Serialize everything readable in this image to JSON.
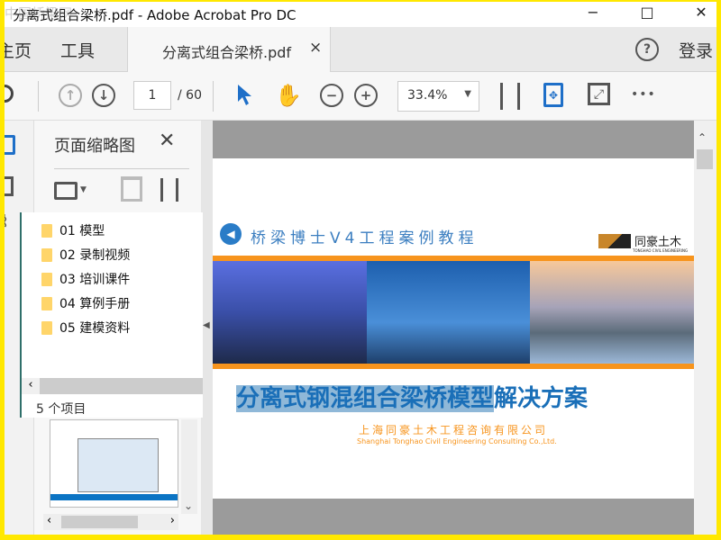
{
  "window": {
    "title": "分离式组合梁桥.pdf - Adobe Acrobat Pro DC",
    "watermark": "中国桥梁网",
    "minimize": "−",
    "maximize": "□",
    "close": "✕"
  },
  "tabs": {
    "home": "主页",
    "tools": "工具",
    "document": "分离式组合梁桥.pdf",
    "doc_close": "×",
    "help": "?",
    "login": "登录"
  },
  "toolbar": {
    "page_current": "1",
    "page_total": "/ 60",
    "zoom": "33.4%",
    "more": "•••"
  },
  "panel": {
    "title": "页面缩略图",
    "close": "✕"
  },
  "folders": {
    "items": [
      "01 模型",
      "02 录制视频",
      "03 培训课件",
      "04 算例手册",
      "05 建模资料"
    ],
    "status": "5 个项目"
  },
  "page": {
    "series_title": "桥梁博士V4工程案例教程",
    "logo_text": "同豪土木",
    "logo_sub": "TONGHAO CIVIL ENGINEERING",
    "main_title_selected": "分离式钢混组合梁桥模型",
    "main_title_rest": "解决方案",
    "company_cn": "上海同豪土木工程咨询有限公司",
    "company_en": "Shanghai  Tonghao Civil Engineering Consulting Co.,Ltd."
  },
  "colors": {
    "accent": "#1e6fc8",
    "orange": "#f7941d",
    "title_blue": "#1a6fb8",
    "selection": "#8fb8d8"
  }
}
